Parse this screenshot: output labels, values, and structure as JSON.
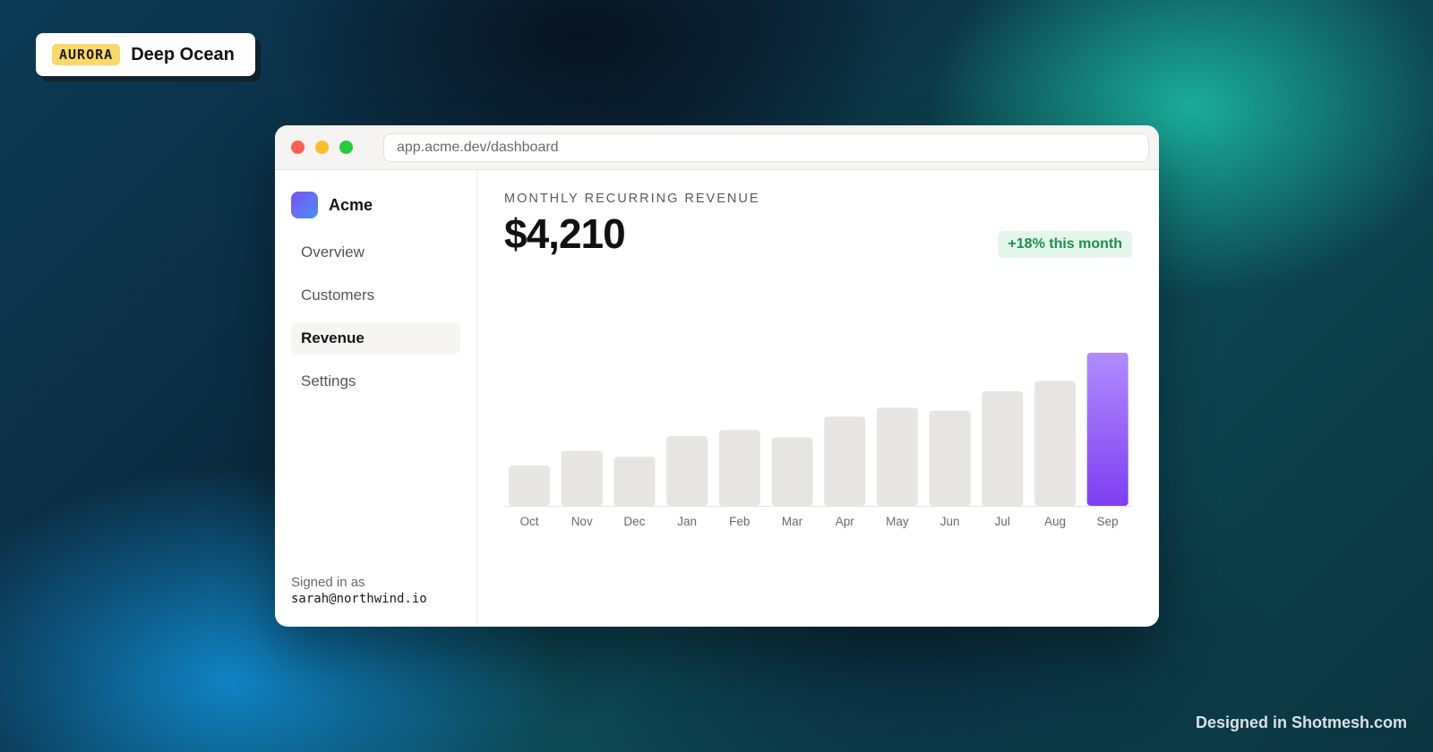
{
  "brand": {
    "tag": "AURORA",
    "name": "Deep Ocean"
  },
  "credit": "Designed in Shotmesh.com",
  "window": {
    "url": "app.acme.dev/dashboard"
  },
  "sidebar": {
    "app_name": "Acme",
    "items": [
      {
        "label": "Overview",
        "active": false
      },
      {
        "label": "Customers",
        "active": false
      },
      {
        "label": "Revenue",
        "active": true
      },
      {
        "label": "Settings",
        "active": false
      }
    ],
    "signin_label": "Signed in as",
    "signin_email": "sarah@northwind.io"
  },
  "main": {
    "kpi_label": "MONTHLY RECURRING REVENUE",
    "kpi_value": "$4,210",
    "badge": "+18% this month"
  },
  "colors": {
    "bar": "#e6e5e4",
    "highlight_top": "#b08cff",
    "highlight_bottom": "#7e3ff0",
    "badge_text": "#1a8f52"
  },
  "chart_data": {
    "type": "bar",
    "categories": [
      "Oct",
      "Nov",
      "Dec",
      "Jan",
      "Feb",
      "Mar",
      "Apr",
      "May",
      "Jun",
      "Jul",
      "Aug",
      "Sep"
    ],
    "values": [
      27,
      37,
      33,
      47,
      51,
      46,
      60,
      66,
      64,
      77,
      84,
      103
    ],
    "highlight_index": 11,
    "ylim": [
      0,
      103
    ],
    "grid": false,
    "title": "",
    "xlabel": "",
    "ylabel": ""
  }
}
